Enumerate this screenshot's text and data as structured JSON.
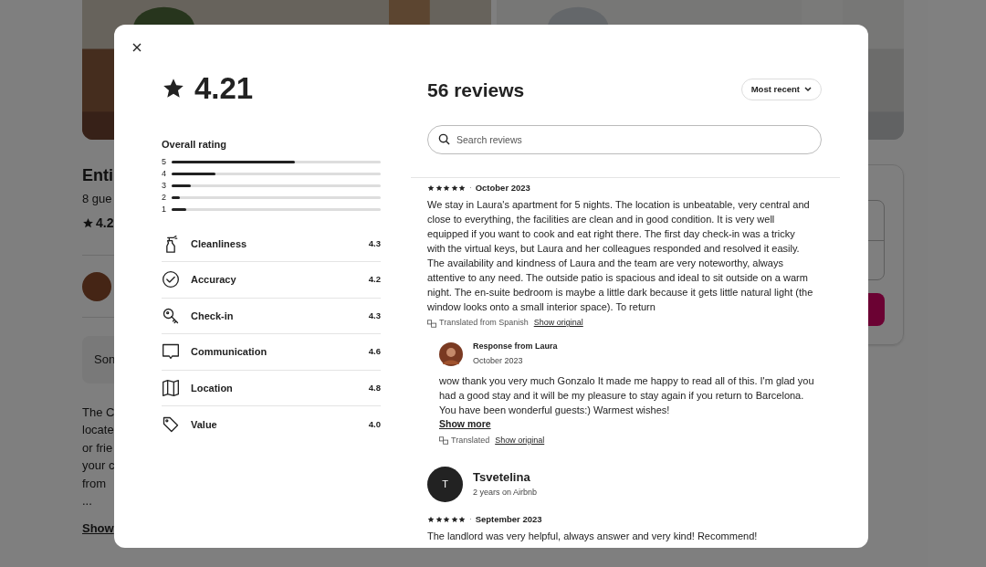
{
  "background_page": {
    "title": "Enti",
    "subtitle": "8 gue",
    "rating": "4.2",
    "highlight": "Son",
    "description_lines": [
      "The C",
      "locate",
      "or frie",
      "your c",
      "from",
      "..."
    ],
    "show_link": "Show"
  },
  "dialog": {
    "rating": "4.21",
    "overall_label": "Overall rating",
    "distribution": [
      {
        "label": "5",
        "level": 0.59
      },
      {
        "label": "4",
        "level": 0.21
      },
      {
        "label": "3",
        "level": 0.09
      },
      {
        "label": "2",
        "level": 0.04
      },
      {
        "label": "1",
        "level": 0.07
      }
    ],
    "categories": [
      {
        "label": "Cleanliness",
        "score": "4.3"
      },
      {
        "label": "Accuracy",
        "score": "4.2"
      },
      {
        "label": "Check-in",
        "score": "4.3"
      },
      {
        "label": "Communication",
        "score": "4.6"
      },
      {
        "label": "Location",
        "score": "4.8"
      },
      {
        "label": "Value",
        "score": "4.0"
      }
    ],
    "reviews_title": "56 reviews",
    "sort": "Most recent",
    "search": {
      "placeholder": "Search reviews"
    },
    "reviews": [
      {
        "stars": 5,
        "separator": "·",
        "date": "October 2023",
        "text": "We stay in Laura's apartment for 5 nights. The location is unbeatable, very central and close to everything, the facilities are clean and in good condition. It is very well equipped if you want to cook and eat right there. The first day check-in was a tricky with the virtual keys, but Laura and her colleagues responded and resolved it easily. The availability and kindness of Laura and the team are very noteworthy, always attentive to any need. The outside patio is spacious and ideal to sit outside on a warm night. The en-suite bedroom is maybe a little dark because it gets little natural light (the window looks onto a small interior space). To return",
        "translation": {
          "note": "Translated from Spanish",
          "link": "Show original"
        },
        "response": {
          "title": "Response from Laura",
          "date": "October 2023",
          "text": "wow thank you very much Gonzalo It made me happy to read all of this. I'm glad you had a good stay and it will be my pleasure to stay again if you return to Barcelona. You have been wonderful guests:) Warmest wishes!",
          "more": "Show more",
          "translation": {
            "note": "Translated",
            "link": "Show original"
          }
        }
      },
      {
        "reviewer": {
          "initial": "T",
          "name": "Tsvetelina",
          "meta": "2 years on Airbnb"
        },
        "stars": 5,
        "separator": "·",
        "date": "September 2023",
        "text": "The landlord was very helpful, always answer and very kind! Recommend!"
      }
    ]
  }
}
